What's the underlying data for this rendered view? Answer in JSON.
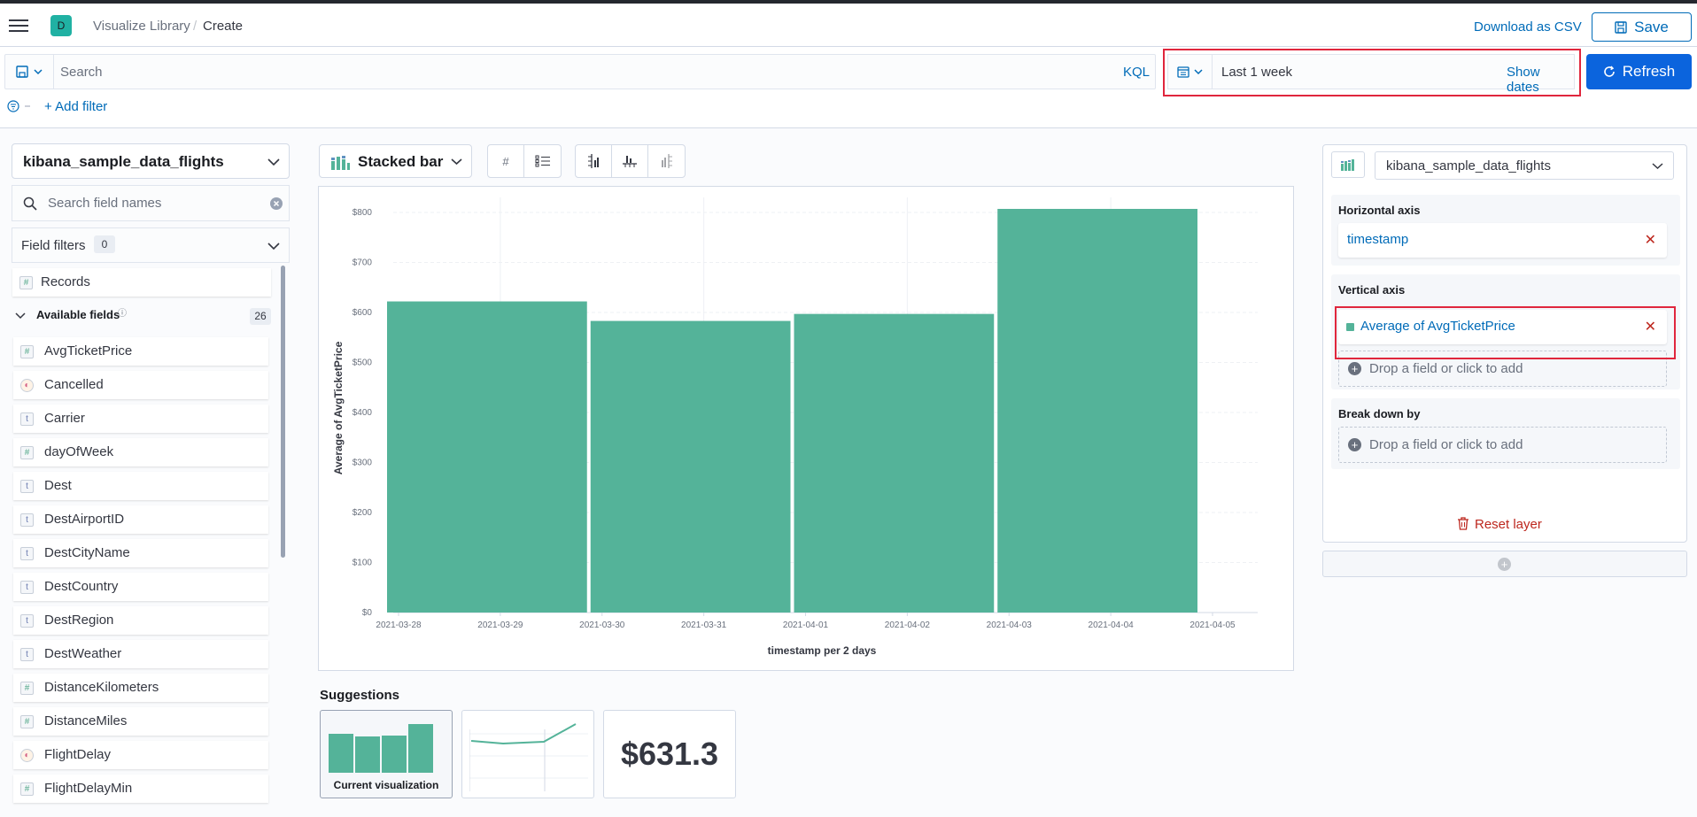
{
  "header": {
    "space_initial": "D",
    "breadcrumb_parent": "Visualize Library",
    "breadcrumb_sep": "/",
    "breadcrumb_current": "Create",
    "download_label": "Download as CSV",
    "save_label": "Save"
  },
  "query": {
    "placeholder": "Search",
    "language": "KQL",
    "time_range": "Last 1 week",
    "show_dates": "Show dates",
    "refresh_label": "Refresh",
    "add_filter": "+ Add filter"
  },
  "left_panel": {
    "index_pattern": "kibana_sample_data_flights",
    "search_placeholder": "Search field names",
    "field_filters_label": "Field filters",
    "field_filters_count": "0",
    "records_label": "Records",
    "available_fields_label": "Available fields",
    "available_fields_count": "26",
    "fields": [
      {
        "name": "AvgTicketPrice",
        "type": "number"
      },
      {
        "name": "Cancelled",
        "type": "boolean"
      },
      {
        "name": "Carrier",
        "type": "string"
      },
      {
        "name": "dayOfWeek",
        "type": "number"
      },
      {
        "name": "Dest",
        "type": "string"
      },
      {
        "name": "DestAirportID",
        "type": "string"
      },
      {
        "name": "DestCityName",
        "type": "string"
      },
      {
        "name": "DestCountry",
        "type": "string"
      },
      {
        "name": "DestRegion",
        "type": "string"
      },
      {
        "name": "DestWeather",
        "type": "string"
      },
      {
        "name": "DistanceKilometers",
        "type": "number"
      },
      {
        "name": "DistanceMiles",
        "type": "number"
      },
      {
        "name": "FlightDelay",
        "type": "boolean"
      },
      {
        "name": "FlightDelayMin",
        "type": "number"
      }
    ]
  },
  "workspace": {
    "chart_type_label": "Stacked bar",
    "suggestions_title": "Suggestions",
    "current_viz_label": "Current visualization",
    "metric_suggestion_value": "$631.3"
  },
  "chart_data": {
    "type": "bar",
    "x_ticks": [
      "2021-03-28",
      "2021-03-29",
      "2021-03-30",
      "2021-03-31",
      "2021-04-01",
      "2021-04-02",
      "2021-04-03",
      "2021-04-04",
      "2021-04-05"
    ],
    "bars": [
      {
        "start": "2021-03-28",
        "end": "2021-03-30",
        "value": 622
      },
      {
        "start": "2021-03-30",
        "end": "2021-04-01",
        "value": 583
      },
      {
        "start": "2021-04-01",
        "end": "2021-04-03",
        "value": 597
      },
      {
        "start": "2021-04-03",
        "end": "2021-04-05",
        "value": 807
      }
    ],
    "y_ticks": [
      "$0",
      "$100",
      "$200",
      "$300",
      "$400",
      "$500",
      "$600",
      "$700",
      "$800"
    ],
    "ylim": [
      0,
      830
    ],
    "xlabel": "timestamp per 2 days",
    "ylabel": "Average of AvgTicketPrice",
    "bar_color": "#54b399",
    "grid": true
  },
  "right_panel": {
    "index_pattern": "kibana_sample_data_flights",
    "horizontal_axis_label": "Horizontal axis",
    "horizontal_axis_value": "timestamp",
    "vertical_axis_label": "Vertical axis",
    "vertical_axis_value": "Average of AvgTicketPrice",
    "drop_field_label": "Drop a field or click to add",
    "breakdown_label": "Break down by",
    "breakdown_drop_label": "Drop a field or click to add",
    "reset_label": "Reset layer"
  },
  "colors": {
    "accent": "#006bb8",
    "primary_button": "#0b64dd",
    "highlight": "#e0263d",
    "danger": "#bd271e",
    "bar": "#54b399"
  }
}
